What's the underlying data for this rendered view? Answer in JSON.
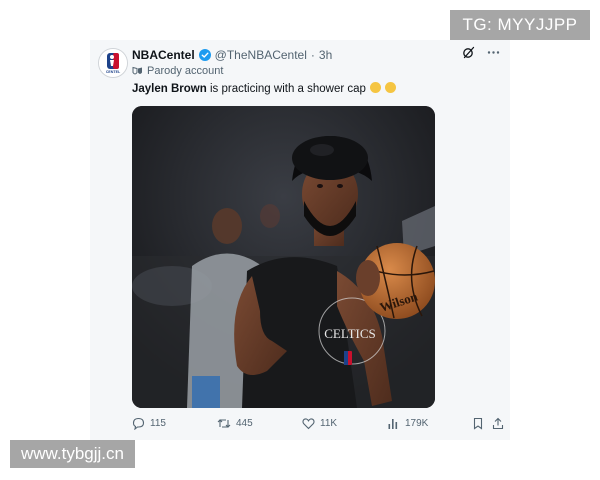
{
  "watermarks": {
    "top": "TG: MYYJJPP",
    "bottom": "www.tybgjj.cn"
  },
  "tweet": {
    "display_name": "NBACentel",
    "handle": "@TheNBACentel",
    "separator": "·",
    "time": "3h",
    "label": "Parody account",
    "text_bold": "Jaylen Brown",
    "text_rest": " is practicing with a shower cap",
    "jersey_text": "CELTICS",
    "ball_brand": "Wilson",
    "avatar_text": "CENTEL",
    "stats": {
      "replies": "115",
      "reposts": "445",
      "likes": "11K",
      "views": "179K"
    }
  },
  "colors": {
    "text_primary": "#0f1419",
    "text_secondary": "#536471",
    "verified": "#1d9bf0",
    "card_bg": "#f5f7f9"
  },
  "icons": [
    "verified-badge-icon",
    "grok-icon",
    "more-icon",
    "parody-mask-icon",
    "reply-icon",
    "repost-icon",
    "like-icon",
    "views-icon",
    "bookmark-icon",
    "share-icon",
    "crying-emoji-icon"
  ]
}
